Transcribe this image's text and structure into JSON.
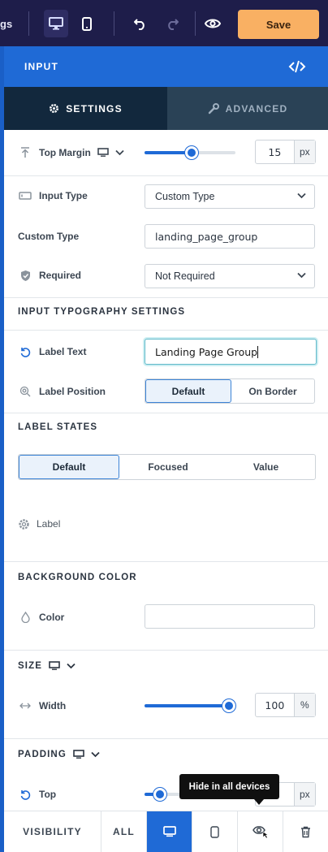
{
  "toolbar": {
    "crumb": "gs",
    "save_label": "Save"
  },
  "panel": {
    "title": "INPUT",
    "tabs": {
      "settings": "SETTINGS",
      "advanced": "ADVANCED"
    }
  },
  "top_margin": {
    "label": "Top Margin",
    "value": "15",
    "unit": "px",
    "level_percent": 56
  },
  "input_type": {
    "label": "Input Type",
    "value": "Custom Type"
  },
  "custom_type": {
    "label": "Custom Type",
    "value": "landing_page_group"
  },
  "required": {
    "label": "Required",
    "value": "Not Required"
  },
  "typography": {
    "title": "INPUT TYPOGRAPHY SETTINGS",
    "label_text": {
      "label": "Label Text",
      "value": "Landing Page Group"
    },
    "label_position": {
      "label": "Label Position",
      "options": [
        "Default",
        "On Border"
      ],
      "selected": "Default"
    }
  },
  "label_states": {
    "title": "LABEL STATES",
    "options": [
      "Default",
      "Focused",
      "Value"
    ],
    "selected": "Default",
    "label_item": "Label"
  },
  "background": {
    "title": "BACKGROUND COLOR",
    "color_label": "Color"
  },
  "size": {
    "title": "SIZE",
    "width_label": "Width",
    "value": "100",
    "unit": "%",
    "level_percent": 100
  },
  "padding": {
    "title": "PADDING",
    "top_label": "Top",
    "unit": "px",
    "level_percent": 18
  },
  "tooltip": "Hide in all devices",
  "visibility": {
    "label": "VISIBILITY",
    "all": "ALL"
  },
  "colors": {
    "brand_blue": "#1f6ad6",
    "save_orange": "#f9b063",
    "toolbar_bg": "#1e1d4a",
    "tab_active": "#12283d"
  },
  "icons": [
    "desktop-icon",
    "mobile-icon",
    "undo-icon",
    "redo-icon",
    "eye-icon",
    "code-icon",
    "gear-icon",
    "wrench-icon",
    "chevron-down-icon",
    "shield-icon",
    "reset-icon",
    "target-icon",
    "droplet-icon",
    "arrows-horizontal-icon",
    "eye-hidden-icon",
    "trash-icon"
  ]
}
